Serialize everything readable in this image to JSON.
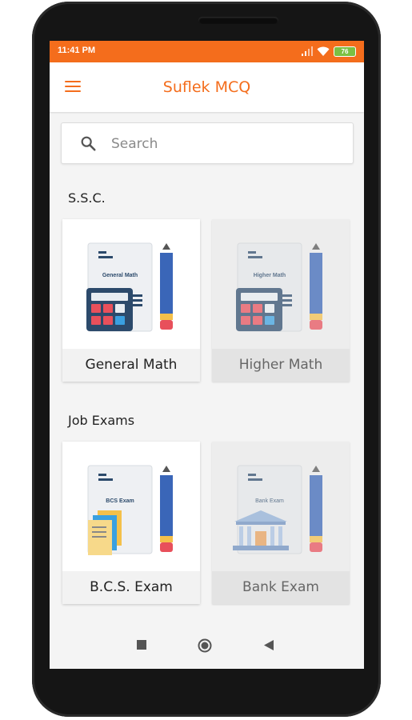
{
  "status": {
    "time": "11:41 PM",
    "battery": "76"
  },
  "app": {
    "title": "Suflek MCQ"
  },
  "search": {
    "placeholder": "Search"
  },
  "sections": [
    {
      "title": "S.S.C.",
      "cards": [
        {
          "label": "General Math",
          "illus_title": "General Math",
          "enabled": true
        },
        {
          "label": "Higher Math",
          "illus_title": "Higher Math",
          "enabled": false
        }
      ]
    },
    {
      "title": "Job Exams",
      "cards": [
        {
          "label": "B.C.S. Exam",
          "illus_title": "BCS Exam",
          "enabled": true
        },
        {
          "label": "Bank Exam",
          "illus_title": "Bank Exam",
          "enabled": false
        }
      ]
    }
  ],
  "colors": {
    "accent": "#f46d1c",
    "pencil_body": "#3a66b8",
    "pencil_tip": "#f4c04a",
    "eraser": "#e8505b",
    "calculator": "#2c4a6b"
  },
  "nav": {
    "icons": [
      "recent-apps-icon",
      "home-icon",
      "back-icon"
    ]
  }
}
